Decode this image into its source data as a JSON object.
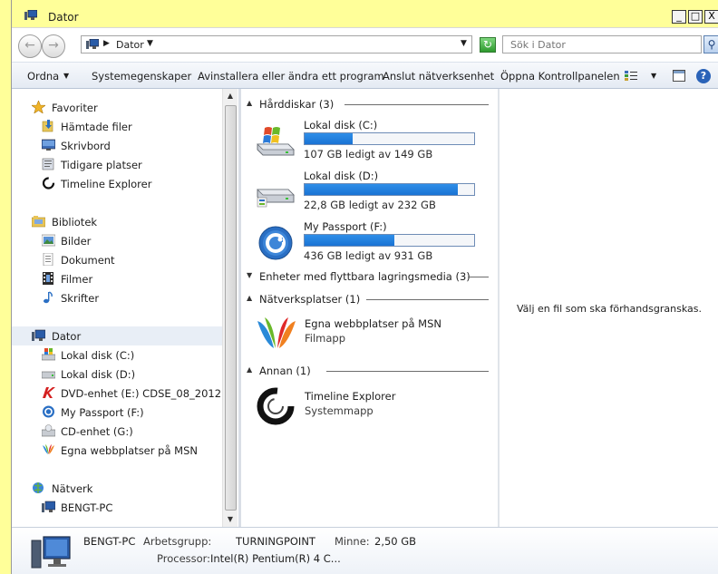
{
  "window": {
    "title": "Dator",
    "min_glyph": "_",
    "max_glyph": "□",
    "close_glyph": "X"
  },
  "address": {
    "crumb": "Dator",
    "search_placeholder": "Sök i Dator"
  },
  "toolbar": {
    "organize": "Ordna",
    "system_properties": "Systemegenskaper",
    "uninstall": "Avinstallera eller ändra ett program",
    "map_drive": "Anslut nätverksenhet",
    "control_panel": "Öppna Kontrollpanelen",
    "help_glyph": "?"
  },
  "nav": {
    "favorites": {
      "label": "Favoriter",
      "items": [
        {
          "label": "Hämtade filer",
          "icon": "downloads-icon"
        },
        {
          "label": "Skrivbord",
          "icon": "desktop-icon"
        },
        {
          "label": "Tidigare platser",
          "icon": "recent-places-icon"
        },
        {
          "label": "Timeline Explorer",
          "icon": "timeline-explorer-icon"
        }
      ]
    },
    "libraries": {
      "label": "Bibliotek",
      "items": [
        {
          "label": "Bilder",
          "icon": "pictures-icon"
        },
        {
          "label": "Dokument",
          "icon": "documents-icon"
        },
        {
          "label": "Filmer",
          "icon": "videos-icon"
        },
        {
          "label": "Skrifter",
          "icon": "music-icon"
        }
      ]
    },
    "computer": {
      "label": "Dator",
      "items": [
        {
          "label": "Lokal disk (C:)",
          "icon": "windows-drive-icon"
        },
        {
          "label": "Lokal disk (D:)",
          "icon": "drive-icon"
        },
        {
          "label": "DVD-enhet (E:) CDSE_08_2012",
          "icon": "dvd-drive-icon"
        },
        {
          "label": "My Passport (F:)",
          "icon": "external-drive-icon"
        },
        {
          "label": "CD-enhet (G:)",
          "icon": "cd-drive-icon"
        },
        {
          "label": "Egna webbplatser på MSN",
          "icon": "msn-icon"
        }
      ]
    },
    "network": {
      "label": "Nätverk",
      "items": [
        {
          "label": "BENGT-PC",
          "icon": "network-computer-icon"
        }
      ]
    }
  },
  "content": {
    "groups": {
      "hard_drives": "Hårddiskar (3)",
      "removable": "Enheter med flyttbara lagringsmedia (3)",
      "network_locations": "Nätverksplatser (1)",
      "other": "Annan (1)"
    },
    "drives": [
      {
        "name": "Lokal disk (C:)",
        "free": "107 GB ledigt av 149 GB",
        "used_fraction": 0.282
      },
      {
        "name": "Lokal disk (D:)",
        "free": "22,8 GB ledigt av 232 GB",
        "used_fraction": 0.902
      },
      {
        "name": "My Passport (F:)",
        "free": "436 GB ledigt av 931 GB",
        "used_fraction": 0.532
      }
    ],
    "network_item": {
      "name": "Egna webbplatser på MSN",
      "sub": "Filmapp"
    },
    "other_item": {
      "name": "Timeline Explorer",
      "sub": "Systemmapp"
    }
  },
  "preview": {
    "message": "Välj en fil som ska förhandsgranskas."
  },
  "details": {
    "name": "BENGT-PC",
    "workgroup_label": "Arbetsgrupp:",
    "workgroup_value": "TURNINGPOINT",
    "memory_label": "Minne:",
    "memory_value": "2,50 GB",
    "processor_label": "Processor:",
    "processor_value": "Intel(R) Pentium(R) 4 C..."
  },
  "colors": {
    "drive_bar": "#1f7fe0",
    "drive_bar_border": "#6e8cb6",
    "title_bar": "#ffff99"
  }
}
